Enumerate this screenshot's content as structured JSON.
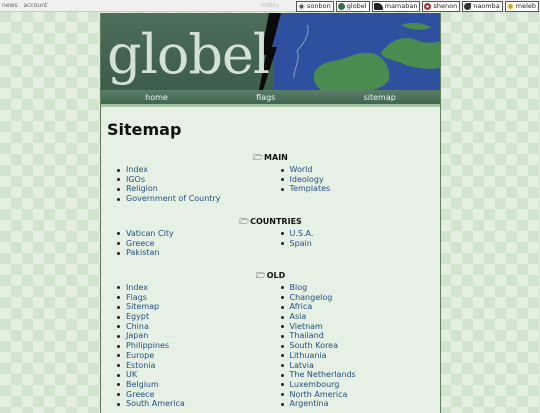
{
  "topbar": {
    "left_links": [
      "news",
      "account"
    ],
    "mid_label": "lobbly",
    "sites": [
      {
        "label": "sonbon",
        "icon": "eye-icon",
        "color": "#555555"
      },
      {
        "label": "globel",
        "icon": "globe-icon",
        "color": "#3a6e4a"
      },
      {
        "label": "mamaban",
        "icon": "bird-icon",
        "color": "#222222"
      },
      {
        "label": "shenon",
        "icon": "flower-icon",
        "color": "#a0302a"
      },
      {
        "label": "naomba",
        "icon": "swirl-icon",
        "color": "#333333"
      },
      {
        "label": "meleb",
        "icon": "sun-icon",
        "color": "#c9a020"
      }
    ]
  },
  "banner": {
    "logo_text": "globel"
  },
  "nav": {
    "items": [
      "home",
      "flags",
      "sitemap"
    ]
  },
  "page": {
    "title": "Sitemap"
  },
  "sections": [
    {
      "title": "MAIN",
      "left": [
        "Index",
        "IGOs",
        "Religion",
        "Government of Country"
      ],
      "right": [
        "World",
        "Ideology",
        "Templates"
      ]
    },
    {
      "title": "COUNTRIES",
      "left": [
        "Vatican City",
        "Greece",
        "Pakistan"
      ],
      "right": [
        "U.S.A.",
        "Spain"
      ]
    },
    {
      "title": "OLD",
      "left": [
        "Index",
        "Flags",
        "Sitemap",
        "Egypt",
        "China",
        "Japan",
        "Philippines",
        "Europe",
        "Estonia",
        "UK",
        "Belgium",
        "Greece",
        "South America"
      ],
      "right": [
        "Blog",
        "Changelog",
        "Africa",
        "Asia",
        "Vietnam",
        "Thailand",
        "South Korea",
        "Lithuania",
        "Latvia",
        "The Netherlands",
        "Luxembourg",
        "North America",
        "Argentina"
      ]
    }
  ]
}
